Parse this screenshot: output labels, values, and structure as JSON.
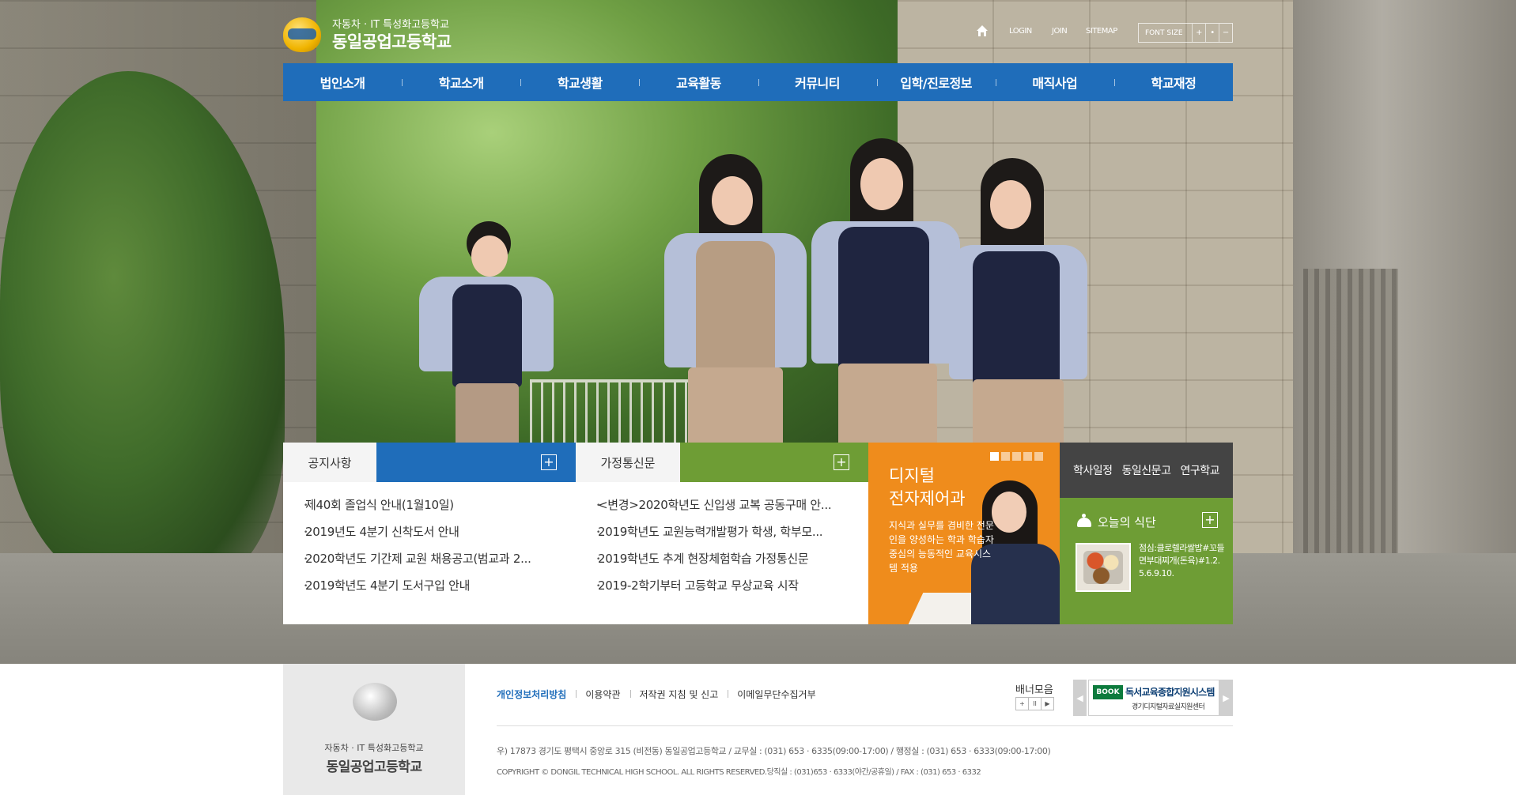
{
  "header": {
    "logo_sub": "자동차 · IT 특성화고등학교",
    "logo_name": "동일공업고등학교",
    "util_links": [
      "LOGIN",
      "JOIN",
      "SITEMAP"
    ],
    "font_size_label": "FONT SIZE",
    "font_size_plus": "+",
    "font_size_reset": "•",
    "font_size_minus": "−"
  },
  "gnb": [
    "법인소개",
    "학교소개",
    "학교생활",
    "교육활동",
    "커뮤니티",
    "입학/진로정보",
    "매직사업",
    "학교재정"
  ],
  "board": {
    "tab1_label": "공지사항",
    "tab2_label": "가정통신문",
    "more": "+",
    "notice_items": [
      "제40회 졸업식 안내(1월10일)",
      "2019년도 4분기 신착도서 안내",
      "2020학년도 기간제 교원 채용공고(범교과 2...",
      "2019학년도 4분기 도서구입 안내"
    ],
    "letter_items": [
      "<변경>2020학년도 신입생 교복 공동구매 안...",
      "2019학년도 교원능력개발평가 학생, 학부모...",
      "2019학년도 추계 현장체험학습 가정통신문",
      "2019-2학기부터 고등학교 무상교육 시작"
    ],
    "bullet": "•"
  },
  "promo": {
    "title_line1": "디지털",
    "title_line2": "전자제어과",
    "desc": "지식과 실무를 겸비한 전문인을 양성하는 학과 학습자 중심의 능동적인 교육시스템 적용"
  },
  "right": {
    "tabs": [
      "학사일정",
      "동일신문고",
      "연구학교"
    ],
    "meal_title": "오늘의 식단",
    "meal_menu": "점심:클로렐라쌀밥#꼬들면부대찌개(돈육)#1.2.5.6.9.10."
  },
  "footer": {
    "logo_sub": "자동차 · IT 특성화고등학교",
    "logo_name": "동일공업고등학교",
    "links": [
      "개인정보처리방침",
      "이용약관",
      "저작권 지침 및 신고",
      "이메일무단수집거부"
    ],
    "banner_label": "배너모음",
    "banner_ctrl": [
      "+",
      "II",
      "▶"
    ],
    "banner_title": "독서교육종합지원시스템",
    "banner_sub": "경기디지털자료실지원센터",
    "banner_book": "BOOK",
    "arrow_left": "◀",
    "arrow_right": "▶",
    "address": "우) 17873 경기도 평택시 중앙로 315 (비전동) 동일공업고등학교 / 교무실 : (031) 653 · 6335(09:00-17:00) / 행정실 : (031) 653 · 6333(09:00-17:00)",
    "copyright": "COPYRIGHT © DONGIL TECHNICAL HIGH SCHOOL. ALL RIGHTS RESERVED.당직실 : (031)653 · 6333(야간/공휴일)   / FAX : (031) 653 · 6332"
  },
  "colors": {
    "primary_blue": "#1f6dba",
    "green": "#6e9d35",
    "orange": "#ef8c1c",
    "dark": "#444444"
  }
}
